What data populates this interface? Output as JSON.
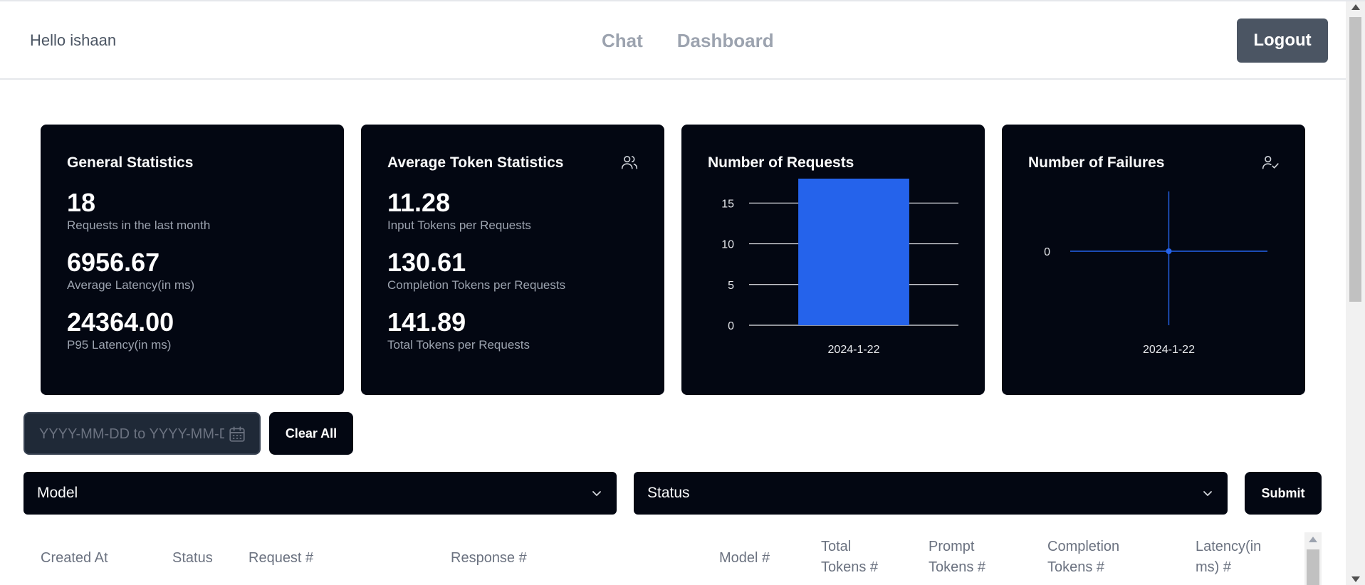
{
  "header": {
    "greeting": "Hello ishaan",
    "nav": [
      {
        "label": "Chat"
      },
      {
        "label": "Dashboard"
      }
    ],
    "logout_label": "Logout"
  },
  "cards": {
    "general": {
      "title": "General Statistics",
      "stats": [
        {
          "value": "18",
          "label": "Requests in the last month"
        },
        {
          "value": "6956.67",
          "label": "Average Latency(in ms)"
        },
        {
          "value": "24364.00",
          "label": "P95 Latency(in ms)"
        }
      ]
    },
    "tokens": {
      "title": "Average Token Statistics",
      "icon": "users-icon",
      "stats": [
        {
          "value": "11.28",
          "label": "Input Tokens per Requests"
        },
        {
          "value": "130.61",
          "label": "Completion Tokens per Requests"
        },
        {
          "value": "141.89",
          "label": "Total Tokens per Requests"
        }
      ]
    },
    "requests": {
      "title": "Number of Requests"
    },
    "failures": {
      "title": "Number of Failures",
      "icon": "user-check-icon"
    }
  },
  "chart_data": [
    {
      "type": "bar",
      "title": "Number of Requests",
      "categories": [
        "2024-1-22"
      ],
      "values": [
        18
      ],
      "yticks": [
        "0",
        "5",
        "10",
        "15"
      ],
      "ylim": [
        0,
        18
      ],
      "grid": true,
      "color": "#2563eb"
    },
    {
      "type": "line",
      "title": "Number of Failures",
      "categories": [
        "2024-1-22"
      ],
      "values": [
        0
      ],
      "yticks": [
        "0"
      ],
      "grid": true,
      "color": "#2563eb"
    }
  ],
  "filters": {
    "date_placeholder": "YYYY-MM-DD to YYYY-MM-DD",
    "clear_label": "Clear All",
    "model_label": "Model",
    "status_label": "Status",
    "submit_label": "Submit"
  },
  "table": {
    "headers": [
      [
        "Created At"
      ],
      [
        "Status"
      ],
      [
        "Request #"
      ],
      [
        "Response #"
      ],
      [
        "Model #"
      ],
      [
        "Total",
        "Tokens #"
      ],
      [
        "Prompt",
        "Tokens #"
      ],
      [
        "Completion",
        "Tokens #"
      ],
      [
        "Latency(in",
        "ms) #"
      ]
    ]
  },
  "colors": {
    "card_bg": "#030712",
    "accent": "#2563eb",
    "logout_bg": "#4b5563"
  }
}
